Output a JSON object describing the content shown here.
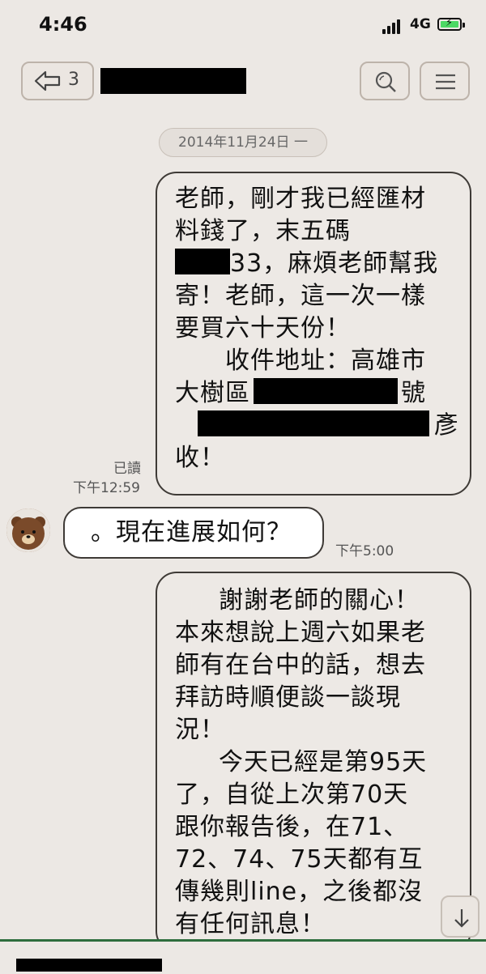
{
  "status": {
    "time": "4:46",
    "network": "4G"
  },
  "header": {
    "back_count": "3"
  },
  "date_separator": "2014年11月24日 一",
  "messages": {
    "out1": {
      "lines": [
        "老師，剛才我已經匯材",
        "料錢了，末五碼",
        "33，麻煩老師幫我",
        "寄！老師，這一次一樣",
        "要買六十天份！",
        "收件地址：高雄市",
        "大樹區",
        "號",
        "彥",
        "收！"
      ],
      "read_label": "已讀",
      "time": "下午12:59"
    },
    "in1": {
      "text": "。現在進展如何？",
      "time": "下午5:00"
    },
    "out2": {
      "lines": [
        "謝謝老師的關心！",
        "本來想說上週六如果老",
        "師有在台中的話，想去",
        "拜訪時順便談一談現",
        "況！",
        "今天已經是第95天",
        "了，自從上次第70天",
        "跟你報告後，在71、",
        "72、74、75天都有互",
        "傳幾則line，之後都沒",
        "有任何訊息！"
      ]
    }
  },
  "colors": {
    "accent": "#2e6d3d",
    "bubble_border": "#3e3a36",
    "background": "#ece8e4"
  }
}
